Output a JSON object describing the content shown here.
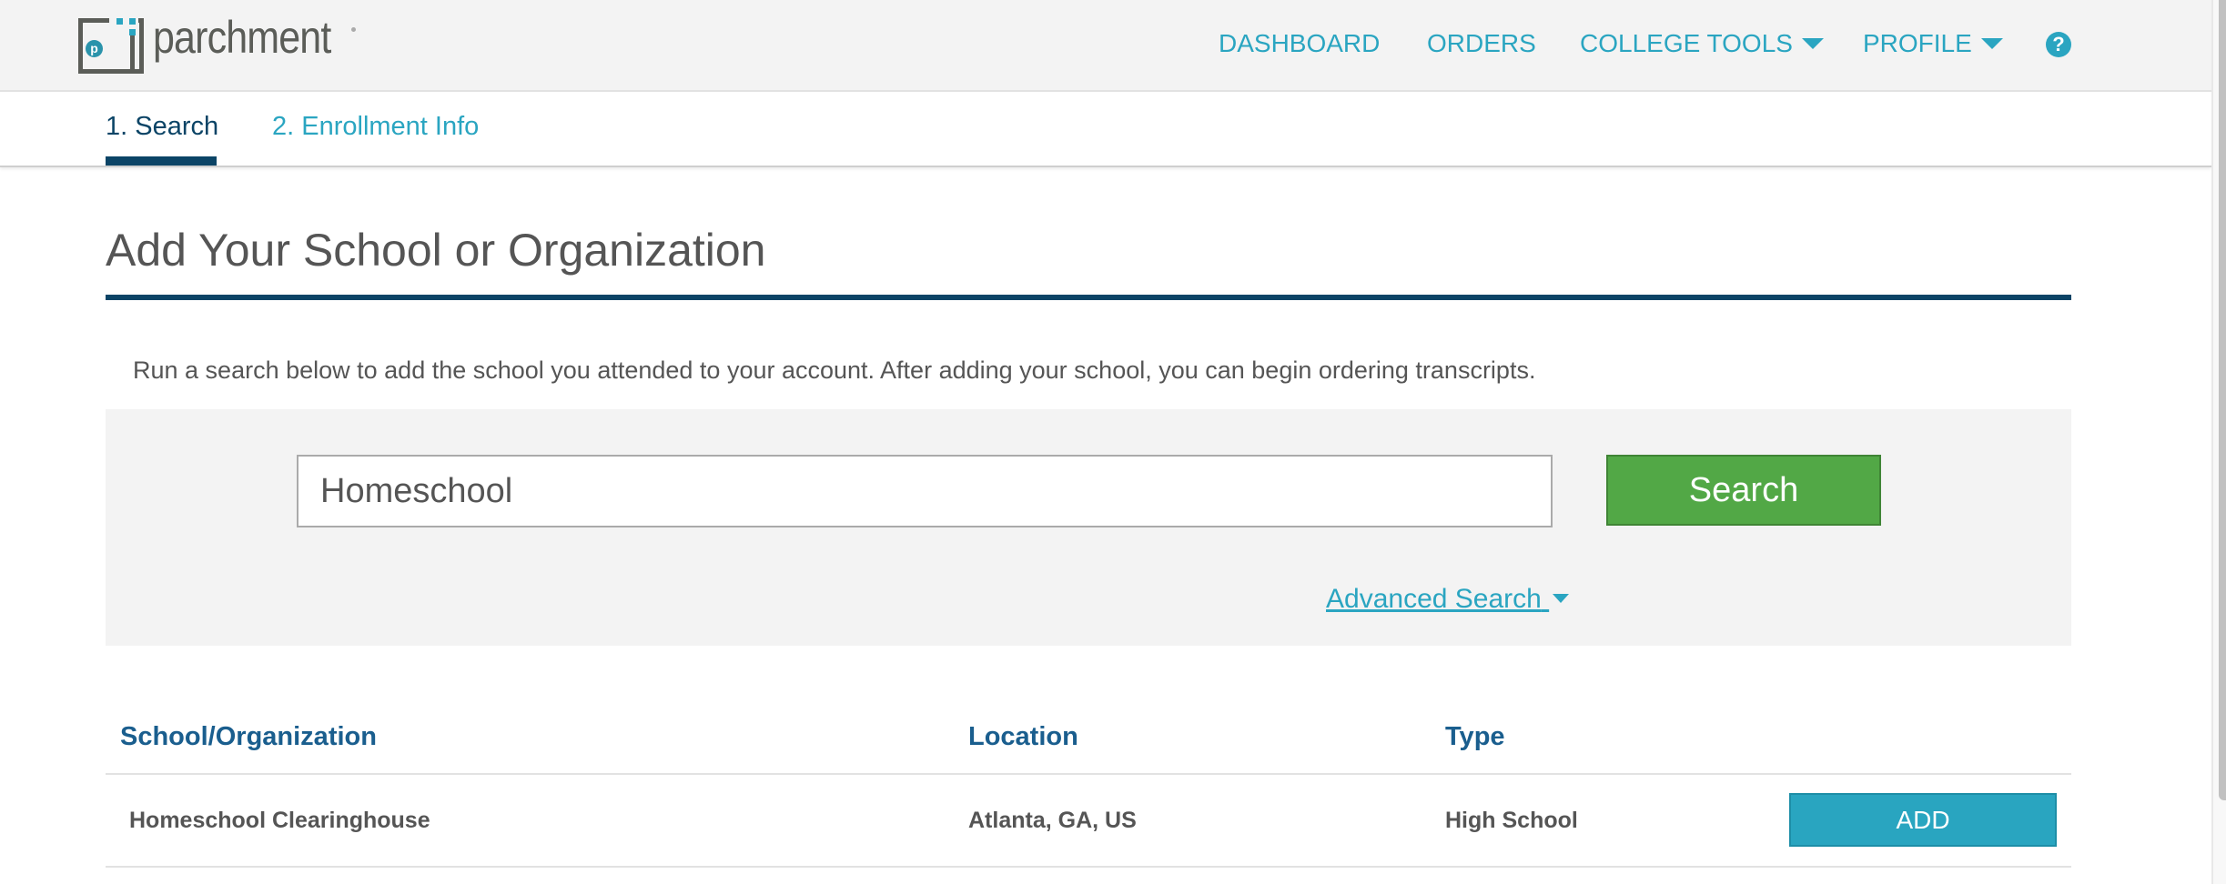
{
  "brand": {
    "name": "parchment",
    "logo_letter": "p"
  },
  "colors": {
    "accent": "#2aa5c1",
    "primary_dark": "#0b4466",
    "search_button": "#52a846",
    "add_button": "#29a5c0",
    "table_header": "#1a5e8e"
  },
  "nav": {
    "dashboard": "DASHBOARD",
    "orders": "ORDERS",
    "college_tools": "COLLEGE TOOLS",
    "profile": "PROFILE",
    "help_icon": "?"
  },
  "tabs": [
    {
      "label": "1. Search",
      "active": true
    },
    {
      "label": "2. Enrollment Info",
      "active": false
    }
  ],
  "page": {
    "title": "Add Your School or Organization",
    "intro": "Run a search below to add the school you attended to your account. After adding your school, you can begin ordering transcripts."
  },
  "search": {
    "value": "Homeschool",
    "button_label": "Search",
    "advanced_label": "Advanced Search"
  },
  "table": {
    "headers": [
      "School/Organization",
      "Location",
      "Type"
    ],
    "rows": [
      {
        "name": "Homeschool Clearinghouse",
        "location": "Atlanta, GA, US",
        "type": "High School",
        "action": "ADD"
      }
    ]
  }
}
